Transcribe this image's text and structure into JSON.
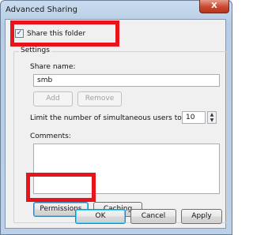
{
  "window": {
    "title": "Advanced Sharing",
    "close_glyph": "X"
  },
  "share_checkbox": {
    "label": "Share this folder",
    "checked": true,
    "check_glyph": "✓"
  },
  "settings": {
    "group_label": "Settings",
    "share_name_label": "Share name:",
    "share_name_value": "smb",
    "add_label": "Add",
    "remove_label": "Remove",
    "limit_label": "Limit the number of simultaneous users to:",
    "limit_value": "10",
    "comments_label": "Comments:",
    "permissions_label": "Permissions",
    "caching_label": "Caching"
  },
  "footer": {
    "ok_label": "OK",
    "cancel_label": "Cancel",
    "apply_label": "Apply"
  },
  "colors": {
    "highlight": "#e8141c"
  }
}
